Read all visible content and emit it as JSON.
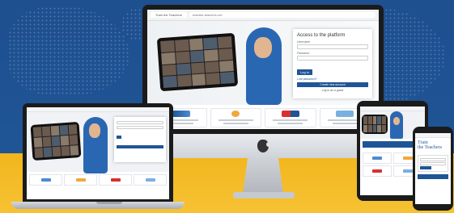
{
  "browser": {
    "tab_title": "Train the Teachers",
    "url": "trainthe-teachers.net"
  },
  "login": {
    "title": "Access to the platform",
    "username_label": "Username",
    "username_value": "",
    "password_label": "Password",
    "password_value": "",
    "login_button": "Log in",
    "forgot_link": "Lost password?",
    "create_button": "Create new account",
    "guest_text": "Log in as a guest"
  },
  "phone": {
    "brand_line1": "Train",
    "brand_line2": "the Teachers"
  },
  "colors": {
    "background_blue": "#1f5596",
    "background_yellow": "#f2b61d",
    "hijab_blue": "#2a67b2"
  }
}
